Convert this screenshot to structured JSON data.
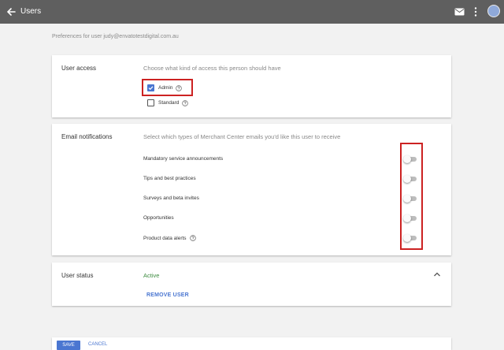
{
  "topbar": {
    "title": "Users",
    "back_icon": "back-arrow-icon",
    "mail_icon": "mail-icon",
    "more_icon": "more-vert-icon"
  },
  "preferences_text": "Preferences for user judy@envatotestdigital.com.au",
  "user_access": {
    "label": "User access",
    "description": "Choose what kind of access this person should have",
    "options": [
      {
        "label": "Admin",
        "checked": true
      },
      {
        "label": "Standard",
        "checked": false
      }
    ]
  },
  "email_notifications": {
    "label": "Email notifications",
    "description": "Select which types of Merchant Center emails you'd like this user to receive",
    "items": [
      {
        "label": "Mandatory service announcements",
        "enabled": false
      },
      {
        "label": "Tips and best practices",
        "enabled": false
      },
      {
        "label": "Surveys and beta invites",
        "enabled": false
      },
      {
        "label": "Opportunities",
        "enabled": false
      },
      {
        "label": "Product data alerts",
        "enabled": false
      }
    ]
  },
  "user_status": {
    "label": "User status",
    "value": "Active",
    "remove_label": "REMOVE USER"
  },
  "footer": {
    "save_label": "SAVE",
    "cancel_label": "CANCEL"
  },
  "colors": {
    "accent": "#4a76d1",
    "active": "#3d8c40",
    "highlight": "#cc2222",
    "topbar": "#5f5f5f"
  }
}
